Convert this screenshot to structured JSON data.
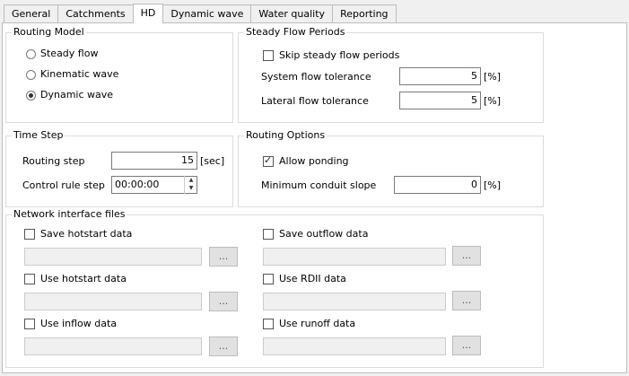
{
  "tabs": [
    "General",
    "Catchments",
    "HD",
    "Dynamic wave",
    "Water quality",
    "Reporting"
  ],
  "routing_model": {
    "legend": "Routing Model",
    "options": [
      "Steady flow",
      "Kinematic wave",
      "Dynamic wave"
    ],
    "selected": "Dynamic wave"
  },
  "steady_flow": {
    "legend": "Steady Flow Periods",
    "skip_label": "Skip steady flow periods",
    "skip_checked": false,
    "system_tol_label": "System flow tolerance",
    "system_tol_value": "5",
    "system_tol_unit": "[%]",
    "lateral_tol_label": "Lateral flow tolerance",
    "lateral_tol_value": "5",
    "lateral_tol_unit": "[%]"
  },
  "time_step": {
    "legend": "Time Step",
    "routing_label": "Routing step",
    "routing_value": "15",
    "routing_unit": "[sec]",
    "control_label": "Control rule step",
    "control_value": "00:00:00"
  },
  "routing_options": {
    "legend": "Routing Options",
    "ponding_label": "Allow ponding",
    "ponding_checked": true,
    "slope_label": "Minimum conduit slope",
    "slope_value": "0",
    "slope_unit": "[%]"
  },
  "interface_files": {
    "legend": "Network interface files",
    "save_hotstart": "Save hotstart data",
    "use_hotstart": "Use hotstart data",
    "use_inflow": "Use inflow data",
    "save_outflow": "Save outflow data",
    "use_rdii": "Use RDII data",
    "use_runoff": "Use runoff data",
    "browse": "..."
  }
}
